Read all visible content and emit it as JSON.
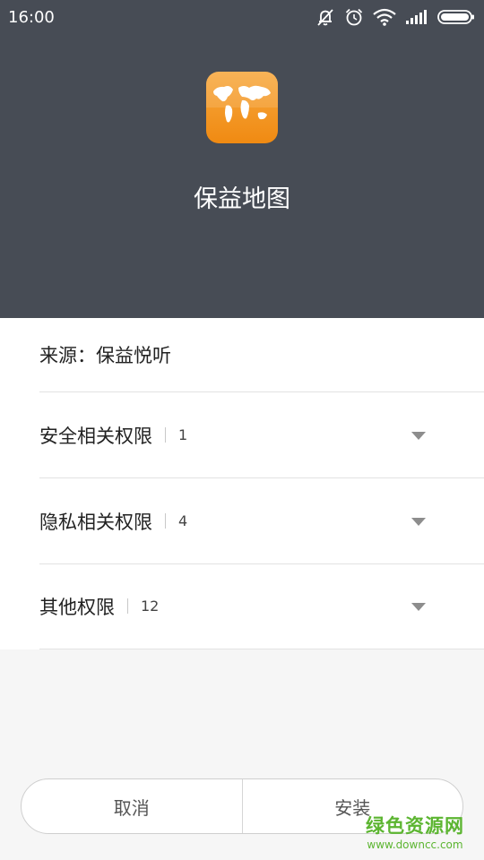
{
  "status_bar": {
    "time": "16:00",
    "icons": [
      "bell-off-icon",
      "alarm-icon",
      "wifi-icon",
      "signal-icon",
      "battery-icon"
    ]
  },
  "app": {
    "icon": "world-map-icon",
    "name": "保益地图",
    "source": "来源：保益悦听"
  },
  "permissions": [
    {
      "label": "安全相关权限",
      "count": "1"
    },
    {
      "label": "隐私相关权限",
      "count": "4"
    },
    {
      "label": "其他权限",
      "count": "12"
    }
  ],
  "buttons": {
    "cancel": "取消",
    "install": "安装"
  },
  "watermark": {
    "title": "绿色资源网",
    "url": "www.downcc.com"
  },
  "colors": {
    "header_bg": "#474c55",
    "icon_orange": "#f08a12",
    "watermark_green": "#5cb531"
  }
}
